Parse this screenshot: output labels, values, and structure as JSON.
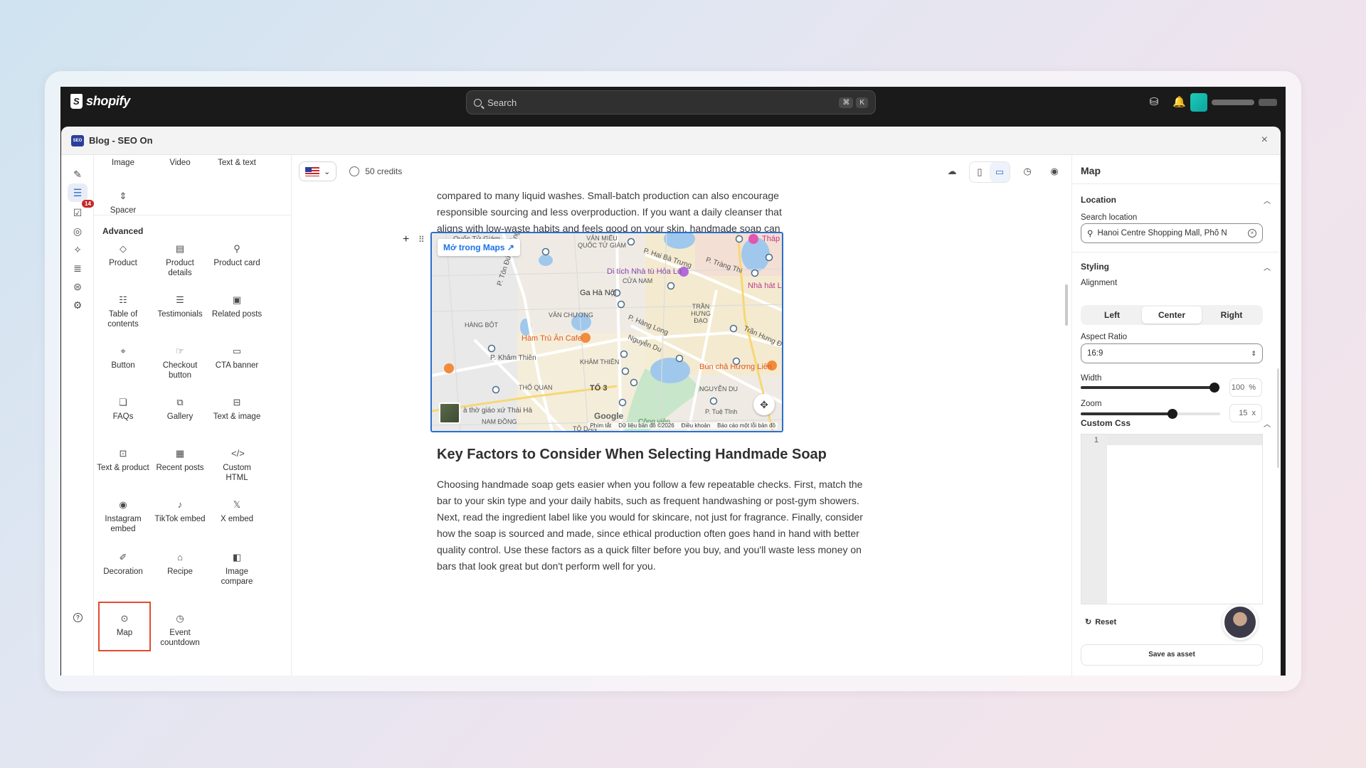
{
  "topbar": {
    "brand": "shopify",
    "search_placeholder": "Search",
    "shortcut_keys": [
      "⌘",
      "K"
    ]
  },
  "app": {
    "badge": "SEO",
    "title": "Blog - SEO On",
    "close_symbol": "×"
  },
  "rail": {
    "badge_count": "14",
    "help_symbol": "?"
  },
  "blocks": {
    "basic_top": [
      "Image",
      "Video",
      "Text & text"
    ],
    "spacer": "Spacer",
    "advanced_label": "Advanced",
    "advanced": [
      {
        "label": "Product",
        "icon": "product-icon"
      },
      {
        "label": "Product details",
        "icon": "product-details-icon"
      },
      {
        "label": "Product card",
        "icon": "product-card-icon"
      },
      {
        "label": "Table of contents",
        "icon": "table-of-contents-icon"
      },
      {
        "label": "Testimonials",
        "icon": "testimonials-icon"
      },
      {
        "label": "Related posts",
        "icon": "related-posts-icon"
      },
      {
        "label": "Button",
        "icon": "button-icon"
      },
      {
        "label": "Checkout button",
        "icon": "checkout-button-icon"
      },
      {
        "label": "CTA banner",
        "icon": "cta-banner-icon"
      },
      {
        "label": "FAQs",
        "icon": "faqs-icon"
      },
      {
        "label": "Gallery",
        "icon": "gallery-icon"
      },
      {
        "label": "Text & image",
        "icon": "text-image-icon"
      },
      {
        "label": "Text & product",
        "icon": "text-product-icon"
      },
      {
        "label": "Recent posts",
        "icon": "recent-posts-icon"
      },
      {
        "label": "Custom HTML",
        "icon": "code-icon"
      },
      {
        "label": "Instagram embed",
        "icon": "instagram-icon"
      },
      {
        "label": "TikTok embed",
        "icon": "tiktok-icon"
      },
      {
        "label": "X embed",
        "icon": "x-icon"
      },
      {
        "label": "Decoration",
        "icon": "brush-icon"
      },
      {
        "label": "Recipe",
        "icon": "recipe-icon"
      },
      {
        "label": "Image compare",
        "icon": "image-compare-icon"
      },
      {
        "label": "Map",
        "icon": "map-pin-icon"
      },
      {
        "label": "Event countdown",
        "icon": "clock-icon"
      }
    ]
  },
  "canvas": {
    "credits": "50 credits",
    "intro_paragraph": "compared to many liquid washes. Small-batch production can also encourage responsible sourcing and less overproduction. If you want a daily cleanser that aligns with low-waste habits and feels good on your skin, handmade soap can be a practical upgrade.",
    "map": {
      "open_link": "Mở trong Maps",
      "labels": [
        "Quốc Tử Giám",
        "VĂN MIẾU QUỐC TỬ GIÁM",
        "P. Hai Bà Trưng",
        "P. Tràng Thi",
        "Tháp",
        "Di tích Nhà tù Hỏa Lò",
        "CỬA NAM",
        "Nhà hát L",
        "Ga Hà Nội",
        "HÀNG BỘT",
        "VĂN CHƯƠNG",
        "TRẦN HƯNG ĐẠO",
        "P. Tôn Đức Thắng",
        "Hàm Trù Ăn Cafe",
        "KHÂM THIÊN",
        "P. Khâm Thiên",
        "P. Hàng Long",
        "Nguyễn Du",
        "Trần Hưng Đ",
        "Bún chả Hương Liên",
        "THỔ QUAN",
        "TỔ 3",
        "NGUYỄN DU",
        "à thờ giáo xứ Thái Hà",
        "NAM ĐỒNG",
        "Công viên",
        "P. Tuệ Tĩnh",
        "TÔ DÂN"
      ],
      "google": "Google",
      "attribution": [
        "Phím tắt",
        "Dữ liệu bản đồ ©2026",
        "Điều khoản",
        "Báo cáo một lỗi bản đồ"
      ]
    },
    "heading": "Key Factors to Consider When Selecting Handmade Soap",
    "body_paragraph": "Choosing handmade soap gets easier when you follow a few repeatable checks. First, match the bar to your skin type and your daily habits, such as frequent handwashing or post-gym showers. Next, read the ingredient label like you would for skincare, not just for fragrance. Finally, consider how the soap is sourced and made, since ethical production often goes hand in hand with better quality control. Use these factors as a quick filter before you buy, and you'll waste less money on bars that look great but don't perform well for you."
  },
  "settings": {
    "title": "Map",
    "location": {
      "section": "Location",
      "search_label": "Search location",
      "search_value": "Hanoi Centre Shopping Mall, Phố N"
    },
    "styling": {
      "section": "Styling",
      "alignment_label": "Alignment",
      "alignment_options": [
        "Left",
        "Center",
        "Right"
      ],
      "alignment_selected": "Center",
      "aspect_label": "Aspect Ratio",
      "aspect_value": "16:9",
      "width_label": "Width",
      "width_value": "100",
      "width_unit": "%",
      "width_fraction": 0.96,
      "zoom_label": "Zoom",
      "zoom_value": "15",
      "zoom_unit": "x",
      "zoom_fraction": 0.66
    },
    "custom_css": {
      "section": "Custom Css",
      "line_number": "1"
    },
    "reset": "Reset",
    "save_asset": "Save as asset"
  },
  "colors": {
    "accent": "#2c6ecb",
    "selected_outline": "#e24b2e"
  }
}
